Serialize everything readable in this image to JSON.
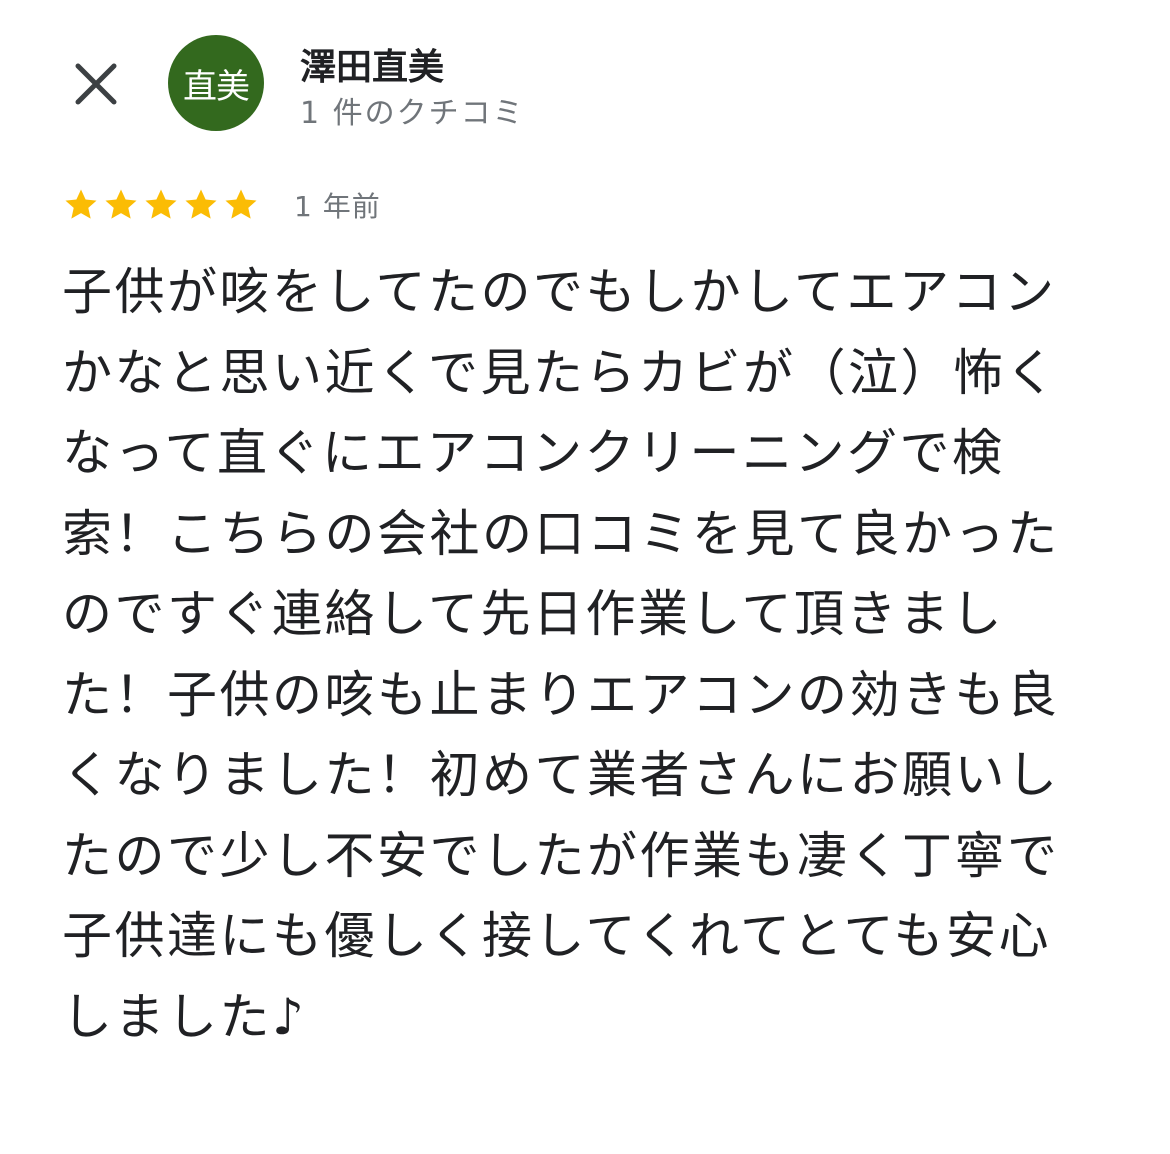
{
  "header": {
    "close_icon": "close-icon",
    "avatar": {
      "initials": "直美",
      "background_color": "#33691e"
    },
    "reviewer_name": "澤田直美",
    "review_count": "1 件のクチコミ"
  },
  "review": {
    "rating": 5,
    "max_rating": 5,
    "star_color": "#fbbc04",
    "time_ago": "1 年前",
    "text": "子供が咳をしてたのでもしかしてエアコンかなと思い近くで見たらカビが（泣）怖くなって直ぐにエアコンクリーニングで検索！こちらの会社の口コミを見て良かったのですぐ連絡して先日作業して頂きました！子供の咳も止まりエアコンの効きも良くなりました！初めて業者さんにお願いしたので少し不安でしたが作業も凄く丁寧で子供達にも優しく接してくれてとても安心しました♪"
  }
}
